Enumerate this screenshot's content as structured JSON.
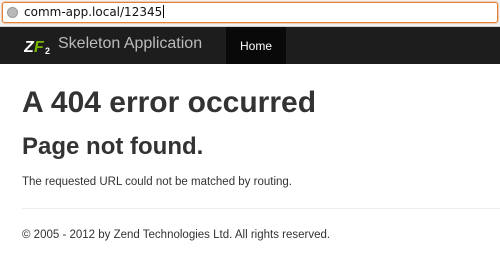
{
  "browser": {
    "url": "comm-app.local/12345"
  },
  "navbar": {
    "logo_text": "ZF2",
    "brand": "Skeleton Application",
    "home_label": "Home"
  },
  "content": {
    "heading": "A 404 error occurred",
    "subheading": "Page not found.",
    "message": "The requested URL could not be matched by routing."
  },
  "footer": {
    "copyright": "© 2005 - 2012 by Zend Technologies Ltd. All rights reserved."
  },
  "colors": {
    "navbar_bg": "#1d1d1d",
    "active_tab_bg": "#090909",
    "logo_green": "#7ab800",
    "url_focus_border": "#e0813d"
  },
  "icons": {
    "url_site_icon": "globe-icon"
  }
}
